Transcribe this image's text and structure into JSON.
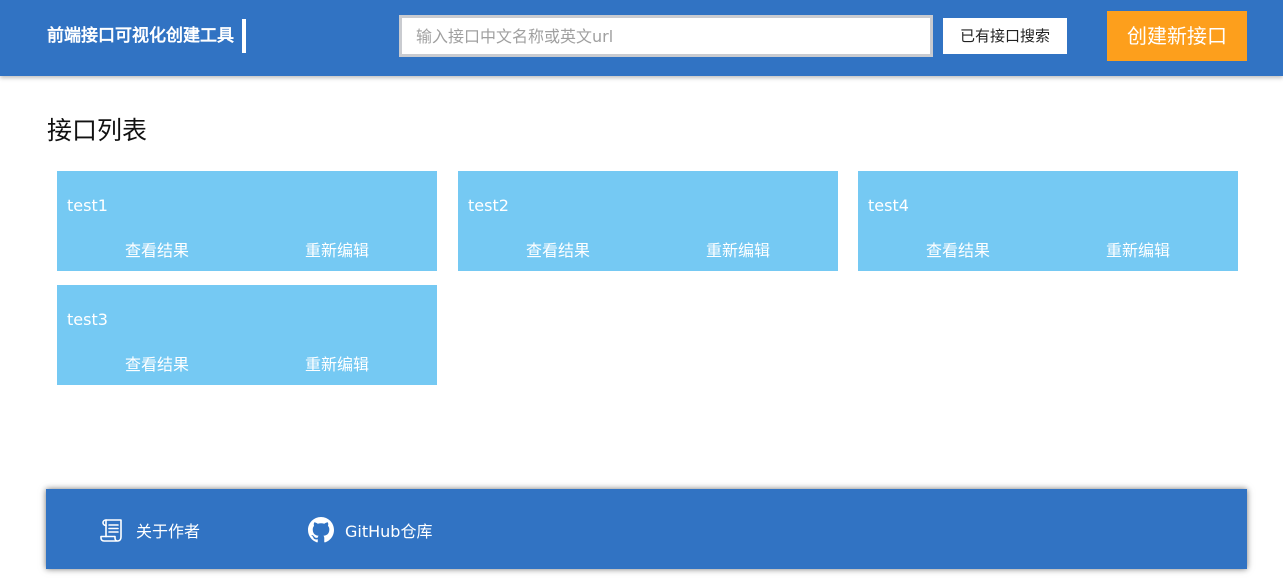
{
  "header": {
    "app_title": "前端接口可视化创建工具",
    "search_placeholder": "输入接口中文名称或英文url",
    "search_value": "",
    "search_button_label": "已有接口搜索",
    "create_button_label": "创建新接口",
    "colors": {
      "bar": "#3173c3",
      "create_button": "#fd9f1c"
    }
  },
  "main": {
    "title": "接口列表",
    "card_color": "#75c9f3",
    "cards": [
      {
        "name": "test1",
        "view_label": "查看结果",
        "edit_label": "重新编辑"
      },
      {
        "name": "test2",
        "view_label": "查看结果",
        "edit_label": "重新编辑"
      },
      {
        "name": "test4",
        "view_label": "查看结果",
        "edit_label": "重新编辑"
      },
      {
        "name": "test3",
        "view_label": "查看结果",
        "edit_label": "重新编辑"
      }
    ]
  },
  "footer": {
    "links": [
      {
        "label": "关于作者",
        "icon": "scroll-icon"
      },
      {
        "label": "GitHub仓库",
        "icon": "github-icon"
      }
    ]
  }
}
